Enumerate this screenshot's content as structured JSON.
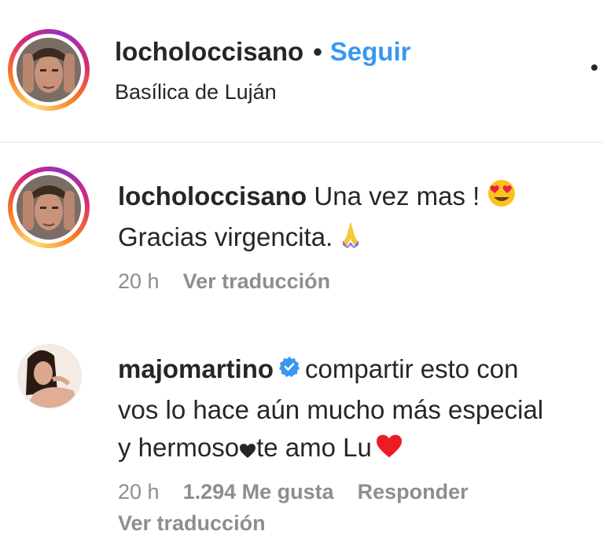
{
  "post_header": {
    "username": "locholoccisano",
    "separator": "•",
    "follow_label": "Seguir",
    "location": "Basílica de Luján"
  },
  "caption": {
    "username": "locholoccisano",
    "text_line1": "Una vez mas !",
    "text_line2": "Gracias virgencita.",
    "emoji_1": "heart-eyes-emoji",
    "emoji_2": "folded-hands-emoji",
    "time": "20 h",
    "translate_label": "Ver traducción"
  },
  "comment": {
    "username": "majomartino",
    "verified_icon": "verified-badge-icon",
    "text_line1": "compartir esto con",
    "text_line2": "vos lo hace aún mucho más especial",
    "text_line3_part1": "y hermoso",
    "text_line3_part2": "te amo Lu",
    "emoji_inline_heart": "black-heart-icon",
    "emoji_end": "red-heart-emoji",
    "time": "20 h",
    "likes": "1.294 Me gusta",
    "reply_label": "Responder",
    "translate_label": "Ver traducción"
  },
  "colors": {
    "link_blue": "#3897f0",
    "text_primary": "#262626",
    "text_secondary": "#8e8e8e",
    "verified_blue": "#3897f0",
    "heart_red": "#ed1c24"
  }
}
